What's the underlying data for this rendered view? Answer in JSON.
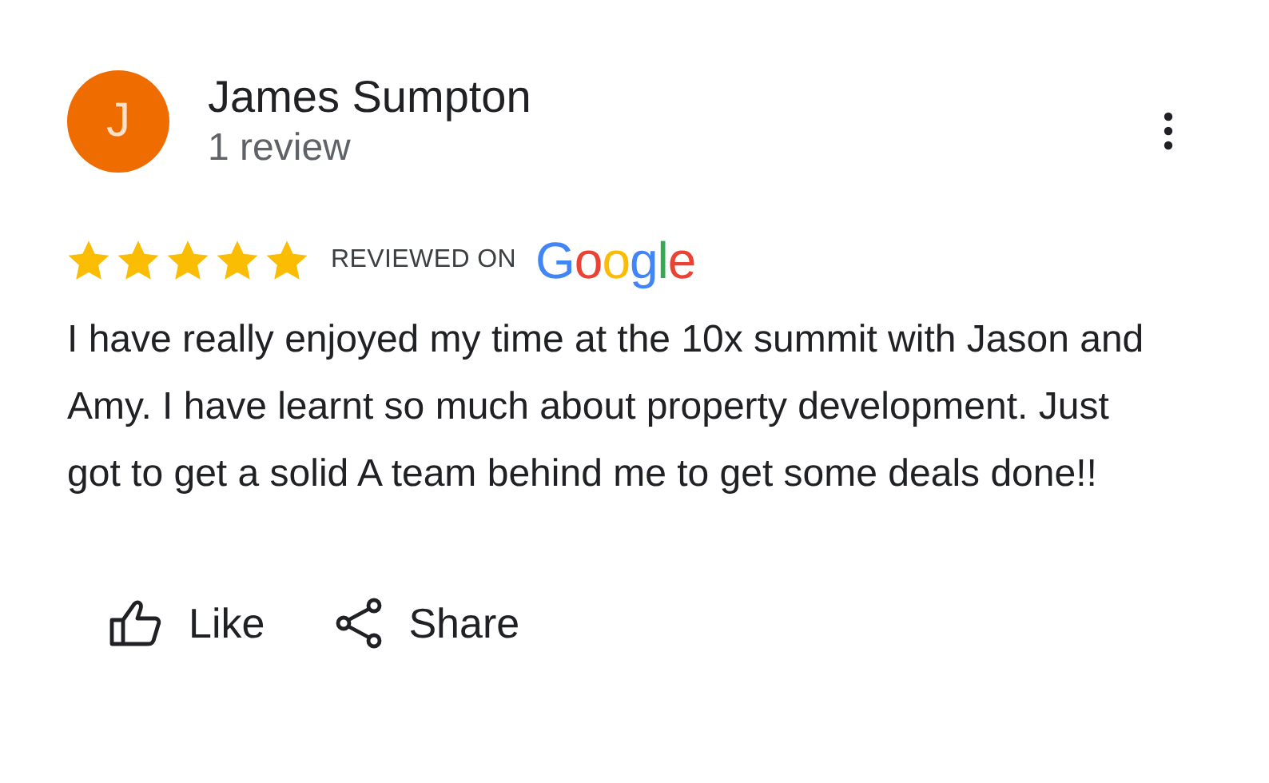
{
  "reviewer": {
    "initial": "J",
    "name": "James Sumpton",
    "review_count": "1 review"
  },
  "rating": {
    "stars": 5,
    "badge_label": "REVIEWED ON",
    "badge_logo": "Google"
  },
  "review_text": "I have really enjoyed my time at the 10x summit with Jason and Amy. I have learnt so much about property development. Just got to get a solid A team behind me to get some deals done!!",
  "actions": [
    {
      "kind": "like",
      "label": "Like"
    },
    {
      "kind": "share",
      "label": "Share"
    }
  ]
}
